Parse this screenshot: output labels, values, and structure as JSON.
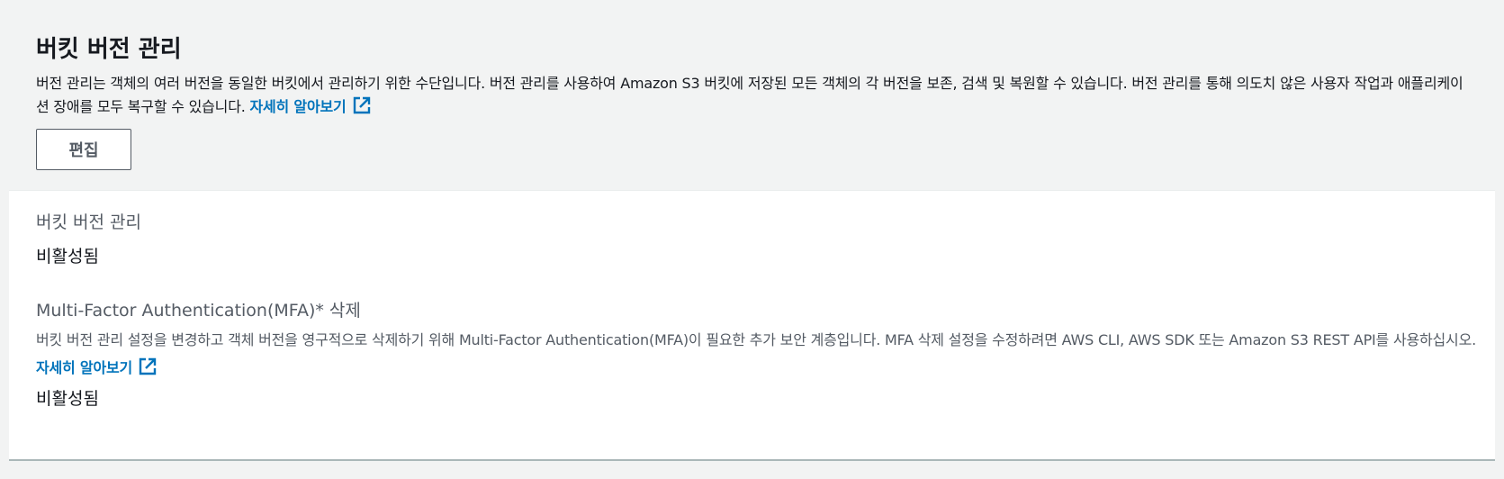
{
  "header": {
    "title": "버킷 버전 관리",
    "description": "버전 관리는 객체의 여러 버전을 동일한 버킷에서 관리하기 위한 수단입니다. 버전 관리를 사용하여 Amazon S3 버킷에 저장된 모든 객체의 각 버전을 보존, 검색 및 복원할 수 있습니다. 버전 관리를 통해 의도치 않은 사용자 작업과 애플리케이션 장애를 모두 복구할 수 있습니다.",
    "learn_more_label": "자세히 알아보기",
    "edit_button_label": "편집"
  },
  "versioning": {
    "label": "버킷 버전 관리",
    "value": "비활성됨"
  },
  "mfa_delete": {
    "label": "Multi-Factor Authentication(MFA)* 삭제",
    "description": "버킷 버전 관리 설정을 변경하고 객체 버전을 영구적으로 삭제하기 위해 Multi-Factor Authentication(MFA)이 필요한 추가 보안 계층입니다. MFA 삭제 설정을 수정하려면 AWS CLI, AWS SDK 또는 Amazon S3 REST API를 사용하십시오.",
    "learn_more_label": "자세히 알아보기",
    "value": "비활성됨"
  },
  "icons": {
    "external_link": "external-link-icon"
  },
  "colors": {
    "link": "#0073bb",
    "header_bg": "#f2f3f3",
    "text": "#16191f",
    "secondary_text": "#545b64"
  }
}
